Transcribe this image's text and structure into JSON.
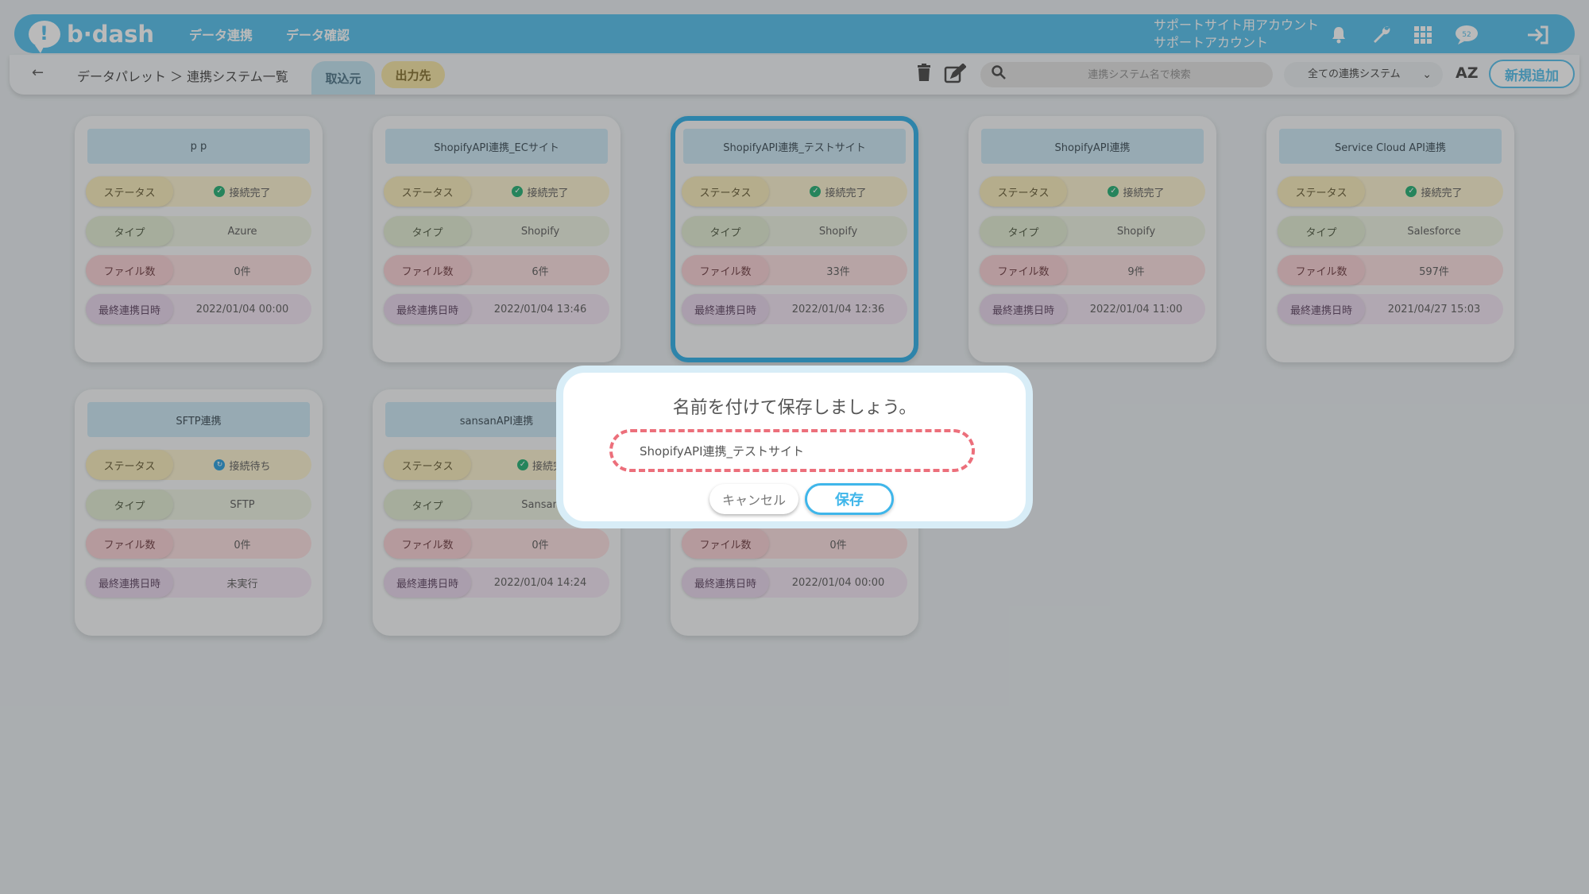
{
  "header": {
    "logo_text": "b·dash",
    "nav": [
      "データ連携",
      "データ確認"
    ],
    "account_line1": "サポートサイト用アカウント",
    "account_line2": "サポートアカウント",
    "icons": [
      "bell-icon",
      "wrench-icon",
      "apps-grid-icon",
      "chat-support-icon",
      "logout-icon"
    ],
    "chat_badge": "52"
  },
  "subbar": {
    "breadcrumb": "データパレット ＞ 連携システム一覧",
    "tab_import": "取込元",
    "tab_export": "出力先",
    "search_placeholder": "連携システム名で検索",
    "filter_value": "全ての連携システム",
    "sort_label": "AZ",
    "new_button": "新規追加"
  },
  "labels": {
    "status": "ステータス",
    "type": "タイプ",
    "files": "ファイル数",
    "last": "最終連携日時"
  },
  "cards": [
    {
      "title": "p p",
      "status": "接続完了",
      "type": "Azure",
      "files": "0件",
      "last": "2022/01/04 00:00"
    },
    {
      "title": "ShopifyAPI連携_ECサイト",
      "status": "接続完了",
      "type": "Shopify",
      "files": "6件",
      "last": "2022/01/04 13:46"
    },
    {
      "title": "ShopifyAPI連携_テストサイト",
      "status": "接続完了",
      "type": "Shopify",
      "files": "33件",
      "last": "2022/01/04 12:36"
    },
    {
      "title": "ShopifyAPI連携",
      "status": "接続完了",
      "type": "Shopify",
      "files": "9件",
      "last": "2022/01/04 11:00"
    },
    {
      "title": "Service Cloud API連携",
      "status": "接続完了",
      "type": "Salesforce",
      "files": "597件",
      "last": "2021/04/27 15:03"
    },
    {
      "title": "SFTP連携",
      "status": "接続待ち",
      "type": "SFTP",
      "files": "0件",
      "last": "未実行"
    },
    {
      "title": "sansanAPI連携",
      "status": "接続完",
      "type": "Sansan",
      "files": "0件",
      "last": "2022/01/04 14:24"
    },
    {
      "title": "",
      "status": "",
      "type": "",
      "files": "0件",
      "last": "2022/01/04 00:00"
    }
  ],
  "modal": {
    "title": "名前を付けて保存しましょう。",
    "name_value": "ShopifyAPI連携_テストサイト",
    "cancel_label": "キャンセル",
    "save_label": "保存"
  },
  "colors": {
    "brand": "#62c4ed",
    "accent_dashed": "#ec6f7b",
    "status_ok": "#35b67e"
  }
}
